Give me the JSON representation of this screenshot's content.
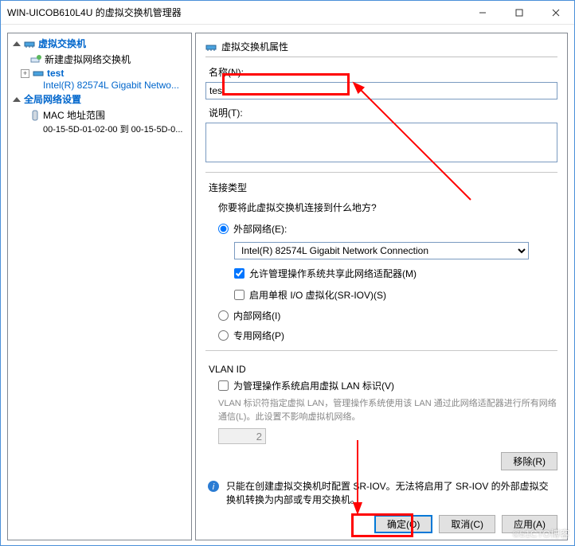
{
  "window": {
    "title": "WIN-UICOB610L4U 的虚拟交换机管理器"
  },
  "tree": {
    "vswitch_header": "虚拟交换机",
    "new_switch": "新建虚拟网络交换机",
    "item_name": "test",
    "item_adapter": "Intel(R) 82574L Gigabit Netwo...",
    "global_header": "全局网络设置",
    "mac_range": "MAC 地址范围",
    "mac_detail": "00-15-5D-01-02-00 到 00-15-5D-0..."
  },
  "panel": {
    "header": "虚拟交换机属性",
    "name_label": "名称(N):",
    "name_value": "test",
    "desc_label": "说明(T):",
    "conn_type": "连接类型",
    "conn_question": "你要将此虚拟交换机连接到什么地方?",
    "ext": "外部网络(E):",
    "adapter": "Intel(R) 82574L Gigabit Network Connection",
    "share_mgmt": "允许管理操作系统共享此网络适配器(M)",
    "sriov": "启用单根 I/O 虚拟化(SR-IOV)(S)",
    "internal": "内部网络(I)",
    "private": "专用网络(P)",
    "vlan_title": "VLAN ID",
    "vlan_check": "为管理操作系统启用虚拟 LAN 标识(V)",
    "vlan_text": "VLAN 标识符指定虚拟 LAN，管理操作系统使用该 LAN 通过此网络适配器进行所有网络通信(L)。此设置不影响虚拟机网络。",
    "vlan_value": "2",
    "remove": "移除(R)",
    "info": "只能在创建虚拟交换机时配置 SR-IOV。无法将启用了 SR-IOV 的外部虚拟交换机转换为内部或专用交换机。"
  },
  "buttons": {
    "ok": "确定(O)",
    "cancel": "取消(C)",
    "apply": "应用(A)"
  },
  "watermark": "©51CTO博客"
}
